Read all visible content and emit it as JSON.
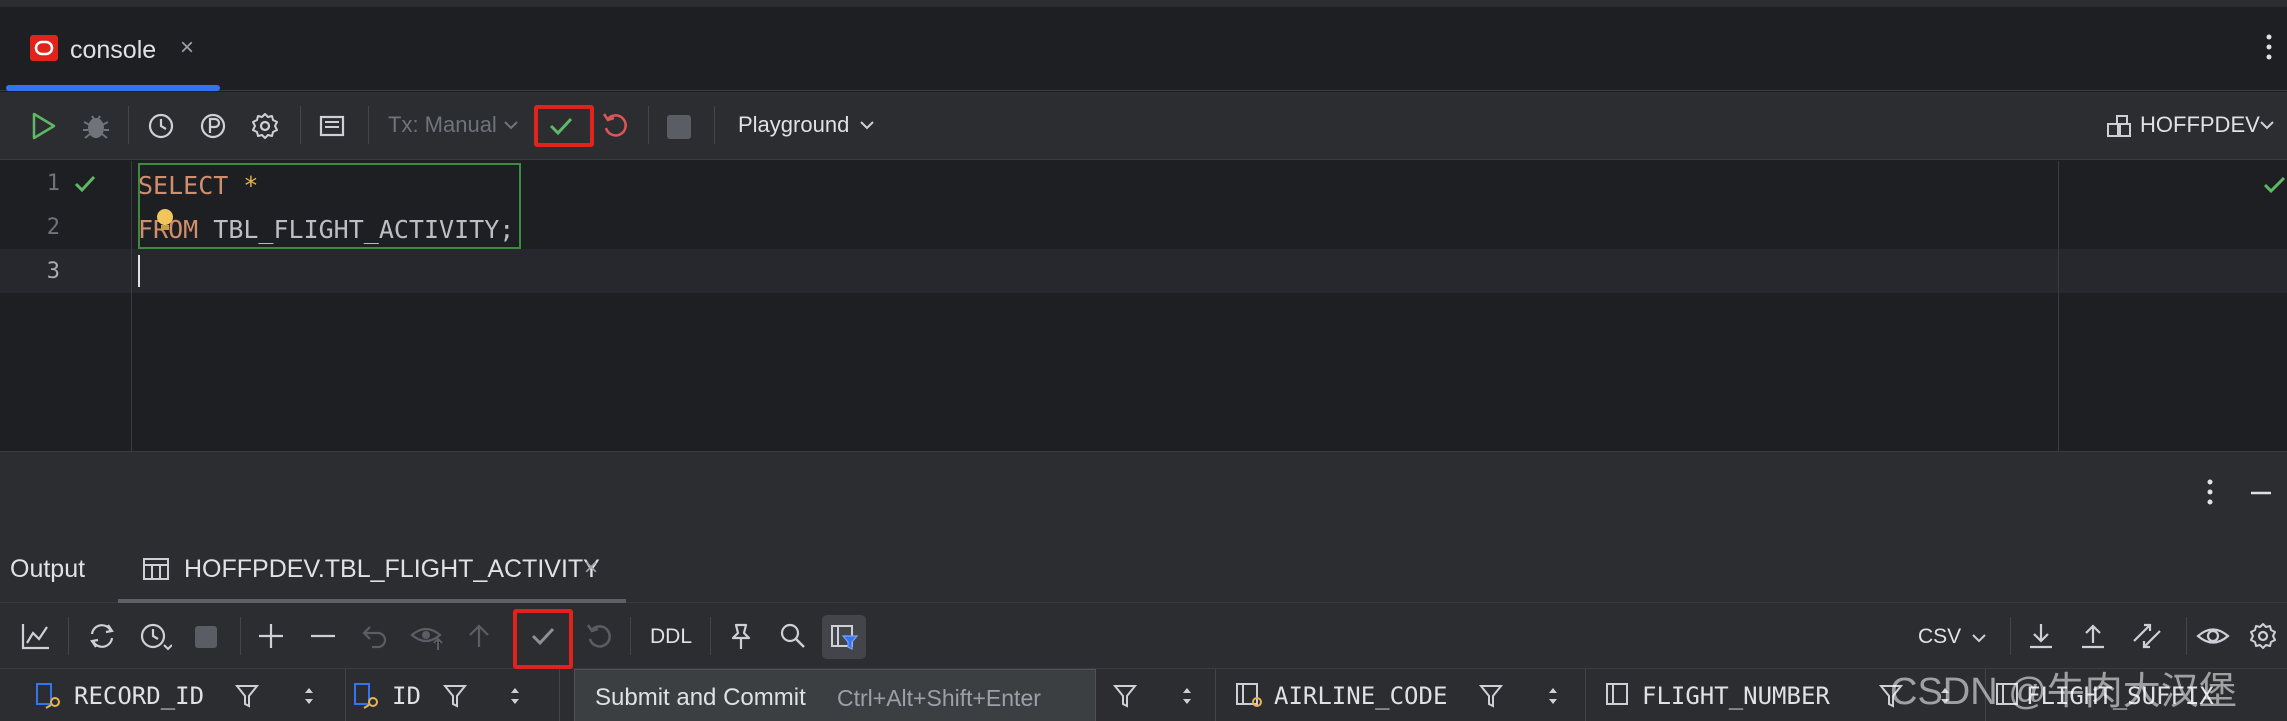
{
  "editor_tabs": [
    {
      "label": "console",
      "close": "×"
    }
  ],
  "toolbar": {
    "tx_mode": "Tx: Manual",
    "playground": "Playground",
    "datasource": "HOFFPDEV"
  },
  "editor": {
    "line_numbers": [
      "1",
      "2",
      "3"
    ],
    "lines": [
      {
        "kw": "SELECT",
        "rest": " *"
      },
      {
        "kw": "FROM",
        "rest": " TBL_FLIGHT_ACTIVITY;"
      }
    ]
  },
  "results": {
    "tabs": [
      "Output",
      "HOFFPDEV.TBL_FLIGHT_ACTIVITY"
    ],
    "close": "×",
    "toolbar": {
      "ddl": "DDL",
      "format": "CSV"
    },
    "columns": [
      "RECORD_ID",
      "ID",
      "AIRLINE_CODE",
      "FLIGHT_NUMBER",
      "FLIGHT_SUFFIX"
    ]
  },
  "tooltip": {
    "title": "Submit and Commit",
    "shortcut": "Ctrl+Alt+Shift+Enter"
  },
  "watermark": "CSDN @牛肉大汉堡",
  "colors": {
    "accent": "#3574f0",
    "highlight_box": "#e0231b",
    "keyword": "#cf8e6d",
    "ok": "#5fb865"
  }
}
